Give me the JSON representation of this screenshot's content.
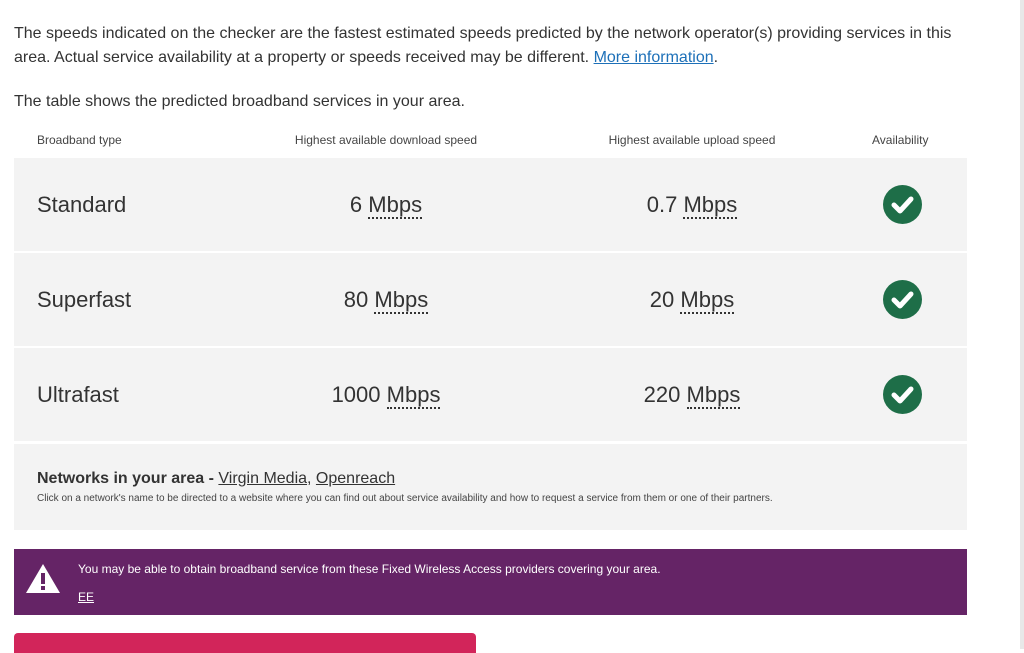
{
  "intro": {
    "text": "The speeds indicated on the checker are the fastest estimated speeds predicted by the network operator(s) providing services in this area. Actual service availability at a property or speeds received may be different. ",
    "link": "More information",
    "end": "."
  },
  "table": {
    "caption": "The table shows the predicted broadband services in your area.",
    "headers": {
      "type": "Broadband type",
      "download": "Highest available download speed",
      "upload": "Highest available upload speed",
      "availability": "Availability"
    },
    "unit": "Mbps",
    "rows": [
      {
        "type": "Standard",
        "download": "6",
        "upload": "0.7",
        "available": "check-icon"
      },
      {
        "type": "Superfast",
        "download": "80",
        "upload": "20",
        "available": "check-icon"
      },
      {
        "type": "Ultrafast",
        "download": "1000",
        "upload": "220",
        "available": "check-icon"
      }
    ]
  },
  "networks": {
    "title": "Networks in your area - ",
    "providers": [
      "Virgin Media",
      "Openreach"
    ],
    "separator": ", ",
    "note": "Click on a network's name to be directed to a website where you can find out about service availability and how to request a service from them or one of their partners."
  },
  "fwa": {
    "message": "You may be able to obtain broadband service from these Fixed Wireless Access providers covering your area.",
    "provider": "EE",
    "icon": "warning-icon"
  },
  "colors": {
    "check": "#1e6e48",
    "banner": "#652466",
    "cta": "#d2255a",
    "link": "#1d70b8"
  }
}
